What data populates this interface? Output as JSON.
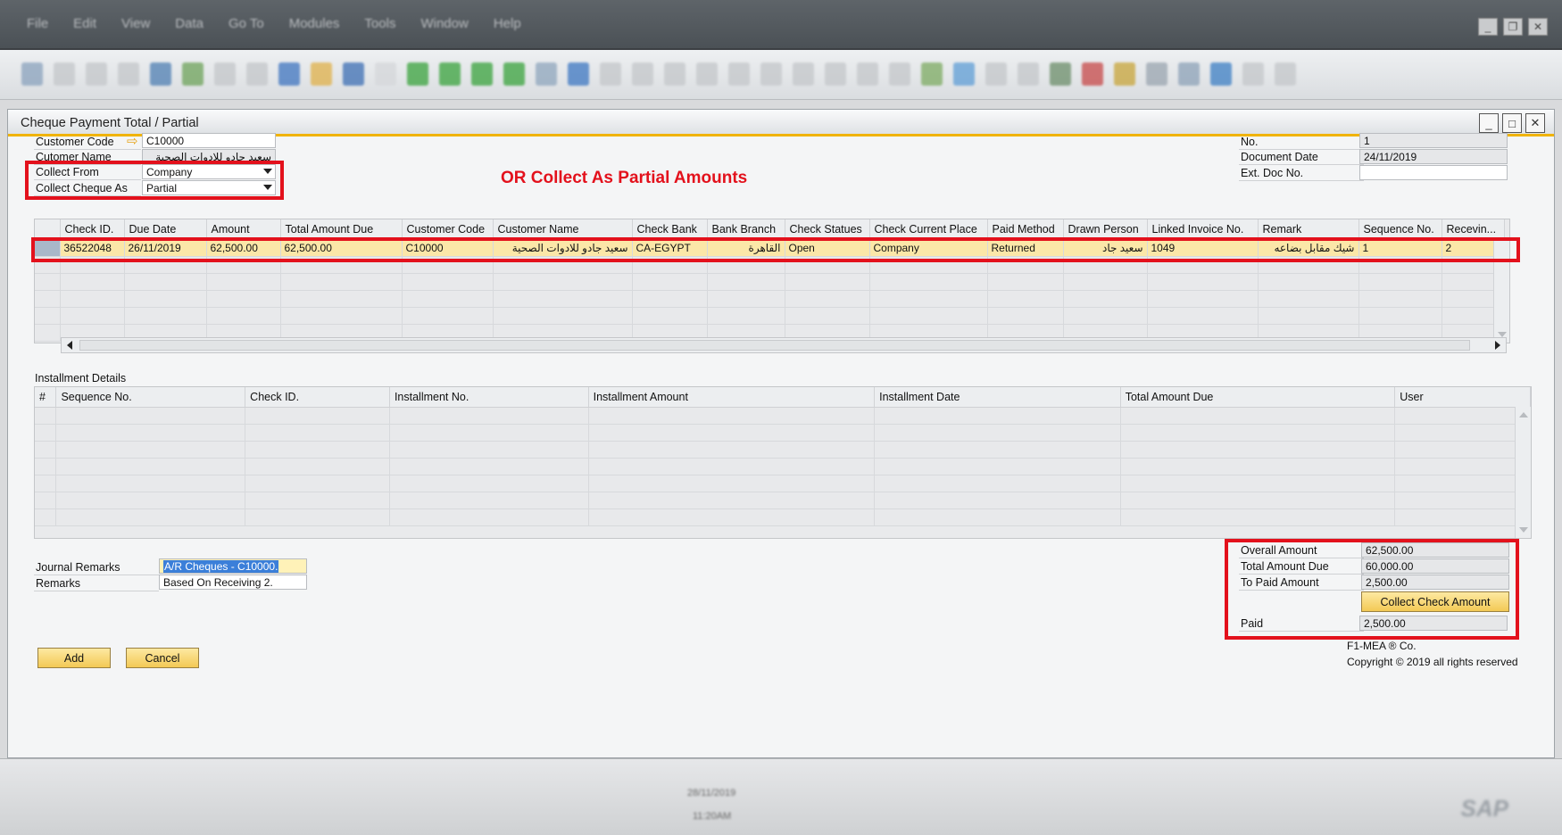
{
  "menu": [
    "File",
    "Edit",
    "View",
    "Data",
    "Go To",
    "Modules",
    "Tools",
    "Window",
    "Help"
  ],
  "window": {
    "title": "Cheque Payment Total / Partial",
    "minimize": "_",
    "maximize": "□",
    "close": "✕"
  },
  "header_left": {
    "customer_code_label": "Customer Code",
    "customer_code": "C10000",
    "customer_name_label": "Cutomer Name",
    "customer_name": "سعيد جادو للادوات الصحية",
    "collect_from_label": "Collect From",
    "collect_from": "Company",
    "collect_cheque_as_label": "Collect Cheque As",
    "collect_cheque_as": "Partial"
  },
  "annotation": "OR Collect As Partial Amounts",
  "header_right": {
    "no_label": "No.",
    "no": "1",
    "document_date_label": "Document Date",
    "document_date": "24/11/2019",
    "ext_doc_label": "Ext. Doc No.",
    "ext_doc": ""
  },
  "cheques_grid": {
    "columns": [
      "Check ID.",
      "Due Date",
      "Amount",
      "Total Amount Due",
      "Customer Code",
      "Customer Name",
      "Check Bank",
      "Bank Branch",
      "Check Statues",
      "Check Current Place",
      "Paid Method",
      "Drawn Person",
      "Linked Invoice No.",
      "Remark",
      "Sequence No.",
      "Recevin..."
    ],
    "rows": [
      [
        "36522048",
        "26/11/2019",
        "62,500.00",
        "62,500.00",
        "C10000",
        "سعيد جادو للادوات الصحية",
        "CA-EGYPT",
        "القاهرة",
        "Open",
        "Company",
        "Returned",
        "سعيد جاد",
        "1049",
        "شيك مقابل بضاعه",
        "1",
        "2"
      ]
    ]
  },
  "installments": {
    "title": "Installment Details",
    "columns": [
      "#",
      "Sequence No.",
      "Check ID.",
      "Installment No.",
      "Installment Amount",
      "Installment Date",
      "Total Amount Due",
      "User"
    ]
  },
  "remarks": {
    "journal_label": "Journal Remarks",
    "journal_value": "A/R Cheques -  C10000.",
    "remarks_label": "Remarks",
    "remarks_value": "Based On Receiving 2."
  },
  "totals": {
    "overall_label": "Overall Amount",
    "overall": "62,500.00",
    "total_due_label": "Total Amount Due",
    "total_due": "60,000.00",
    "to_paid_label": "To Paid Amount",
    "to_paid": "2,500.00",
    "collect_button": "Collect Check Amount",
    "paid_label": "Paid",
    "paid": "2,500.00"
  },
  "buttons": {
    "add": "Add",
    "cancel": "Cancel"
  },
  "footer": {
    "company": "F1-MEA ® Co.",
    "copyright": "Copyright © 2019 all rights reserved"
  },
  "statusbar": {
    "date": "28/11/2019",
    "time": "11:20AM",
    "logo": "SAP"
  },
  "colors": {
    "accent_gold": "#f0b300",
    "annotation_red": "#e3111c",
    "selected_row": "#fbe7a8"
  }
}
